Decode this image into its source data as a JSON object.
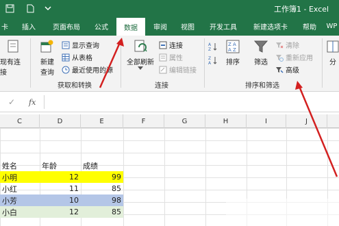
{
  "window": {
    "title": "工作簿1 - Excel"
  },
  "tabs": [
    {
      "label": "卡",
      "active": false
    },
    {
      "label": "插入",
      "active": false
    },
    {
      "label": "页面布局",
      "active": false
    },
    {
      "label": "公式",
      "active": false
    },
    {
      "label": "数据",
      "active": true
    },
    {
      "label": "审阅",
      "active": false
    },
    {
      "label": "视图",
      "active": false
    },
    {
      "label": "开发工具",
      "active": false
    },
    {
      "label": "新建选项卡",
      "active": false
    },
    {
      "label": "帮助",
      "active": false
    },
    {
      "label": "WP",
      "active": false
    }
  ],
  "ribbon": {
    "get_transform": {
      "existing_connections": "现有连接",
      "new_query_line1": "新建",
      "new_query_line2": "查询",
      "show_queries": "显示查询",
      "from_table": "从表格",
      "recent_sources": "最近使用的源",
      "group_label": "获取和转换"
    },
    "connections": {
      "refresh_all": "全部刷新",
      "connections": "连接",
      "properties": "属性",
      "edit_links": "编辑链接",
      "group_label": "连接"
    },
    "sort_filter": {
      "sort": "排序",
      "filter": "筛选",
      "clear": "清除",
      "reapply": "重新应用",
      "advanced": "高级",
      "group_label": "排序和筛选"
    },
    "more": "分"
  },
  "formula_bar": {
    "check_glyph": "✓",
    "fx_label": "fx",
    "value": ""
  },
  "columns": [
    "C",
    "D",
    "E",
    "F",
    "G",
    "H",
    "I",
    "J"
  ],
  "table": {
    "headers": [
      "姓名",
      "年龄",
      "成绩"
    ],
    "rows": [
      {
        "name": "小明",
        "age": "12",
        "score": "99",
        "fill": "yellow"
      },
      {
        "name": "小红",
        "age": "11",
        "score": "85",
        "fill": "none"
      },
      {
        "name": "小芳",
        "age": "10",
        "score": "98",
        "fill": "blue"
      },
      {
        "name": "小白",
        "age": "12",
        "score": "85",
        "fill": "green"
      }
    ]
  },
  "colors": {
    "title_bar": "#227447",
    "active_tab_text": "#1d6b3e",
    "annotation_arrow": "#d32020",
    "row_yellow": "#ffff00",
    "row_blue": "#b4c6e7",
    "row_green": "#e2efda"
  }
}
